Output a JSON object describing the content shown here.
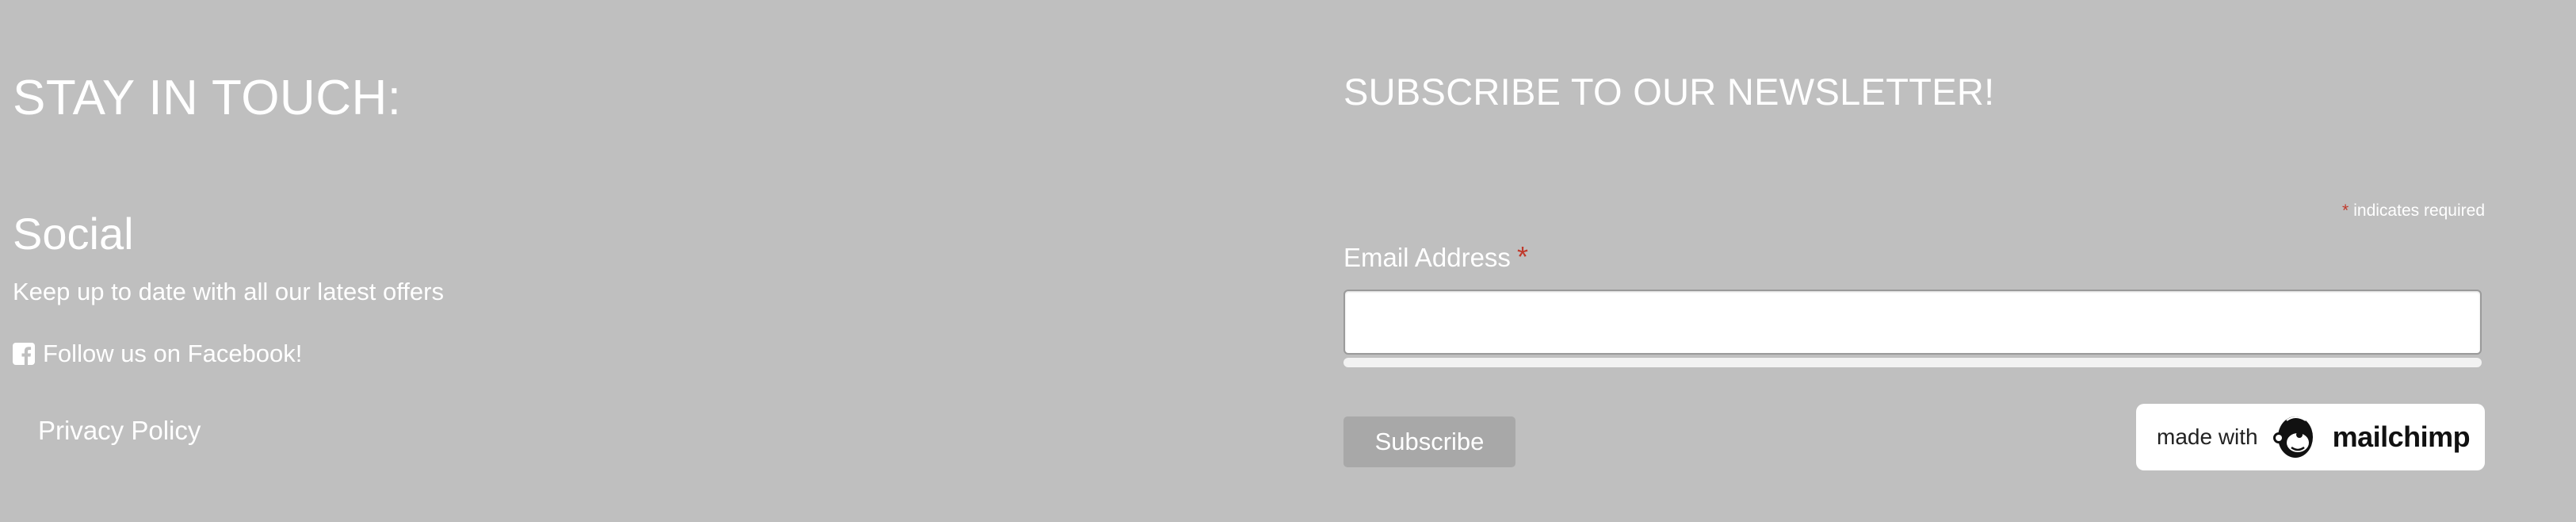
{
  "left": {
    "heading": "STAY IN TOUCH:",
    "social_title": "Social",
    "tagline": "Keep up to date with all our latest offers",
    "facebook": {
      "icon": "facebook-square-icon",
      "label": "Follow us on Facebook!"
    },
    "privacy_label": "Privacy Policy"
  },
  "newsletter": {
    "title": "SUBSCRIBE TO OUR NEWSLETTER!",
    "required_mark": "*",
    "required_note": "indicates required",
    "email_label": "Email Address",
    "email_value": "",
    "subscribe_label": "Subscribe",
    "badge": {
      "made_with": "made with",
      "brand": "mailchimp",
      "icon": "mailchimp-freddie-icon"
    }
  },
  "colors": {
    "background": "#bfbfbf",
    "text": "#ffffff",
    "required": "#c0392b",
    "button": "#a8a8a8"
  }
}
